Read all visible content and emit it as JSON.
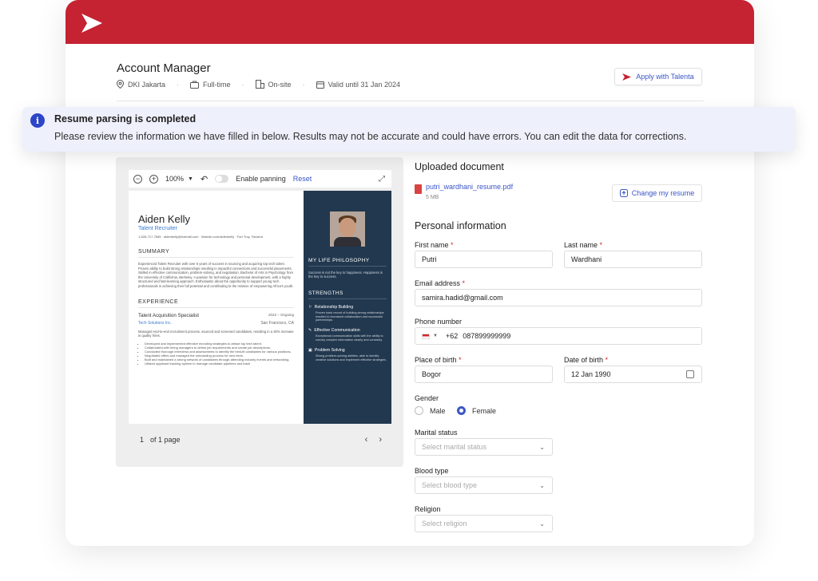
{
  "job": {
    "title": "Account Manager",
    "location": "DKI Jakarta",
    "type": "Full-time",
    "workplace": "On-site",
    "validity": "Valid until 31 Jan 2024",
    "apply_label": "Apply with Talenta"
  },
  "banner": {
    "title": "Resume parsing is completed",
    "message": "Please review the information we have filled in below. Results may not be accurate and could have errors. You can edit the data for corrections."
  },
  "viewer": {
    "zoom": "100%",
    "panning_label": "Enable panning",
    "reset_label": "Reset",
    "page_current": "1",
    "page_total": "of 1 page"
  },
  "resume": {
    "name": "Aiden Kelly",
    "role": "Talent Recruiter",
    "contact": "1-828-717-7665 · aidenkelly@hotmail.com · linkedin.com/aidenkelly · Fort Troy, Farwind",
    "summary_heading": "SUMMARY",
    "summary": "Experienced Talent Recruiter with over 5 years of success in sourcing and acquiring top tech talent. Proven ability to build strong relationships resulting in impactful connections and successful placements. Skilled in effective communication, problem-solving, and negotiation. Bachelor of Arts in Psychology from the University of California, Berkeley. A passion for technology and personal development, with a highly structured and fast-learning approach. Enthusiastic about the opportunity to support young tech professionals in achieving their full potential and contributing to the mission of empowering Africa's youth.",
    "experience_heading": "EXPERIENCE",
    "job_title": "Talent Acquisition Specialist",
    "job_dates": "2022 – Ongoing",
    "company": "Tech Solutions Inc.",
    "company_location": "San Francisco, CA",
    "job_intro": "Managed end-to-end recruitment process, sourced and screened candidates, resulting in a 30% increase in quality hires.",
    "bullets": [
      "Developed and implemented effective recruiting strategies to attract top tech talent.",
      "Collaborated with hiring managers to define job requirements and create job descriptions.",
      "Conducted thorough interviews and assessments to identify the best-fit candidates for various positions.",
      "Negotiated offers and managed the onboarding process for new hires.",
      "Built and maintained a strong network of candidates through attending industry events and networking.",
      "Utilized applicant tracking system to manage candidate pipelines and track"
    ],
    "philosophy_heading": "MY LIFE PHILOSOPHY",
    "philosophy": "Success is not the key to happiness. Happiness is the key to success.",
    "strengths_heading": "STRENGTHS",
    "strengths": [
      {
        "title": "Relationship Building",
        "text": "Proven track record of building strong relationships resulted in increased collaboration and successful partnerships."
      },
      {
        "title": "Effective Communication",
        "text": "Exceptional communication skills with the ability to convey complex information clearly and concisely."
      },
      {
        "title": "Problem Solving",
        "text": "Strong problem-solving abilities, able to identify creative solutions and implement effective strategies."
      }
    ]
  },
  "upload": {
    "heading": "Uploaded document",
    "file_name": "putri_wardhani_resume.pdf",
    "file_size": "5 MB",
    "change_label": "Change my resume"
  },
  "personal": {
    "heading": "Personal information",
    "first_name_label": "First name",
    "first_name": "Putri",
    "last_name_label": "Last name",
    "last_name": "Wardhani",
    "email_label": "Email address",
    "email": "samira.hadid@gmail.com",
    "phone_label": "Phone number",
    "phone_code": "+62",
    "phone": "087899999999",
    "pob_label": "Place of birth",
    "pob": "Bogor",
    "dob_label": "Date of birth",
    "dob": "12 Jan 1990",
    "gender_label": "Gender",
    "gender_male": "Male",
    "gender_female": "Female",
    "gender_selected": "Female",
    "marital_label": "Marital status",
    "marital_placeholder": "Select marital status",
    "blood_label": "Blood  type",
    "blood_placeholder": "Select blood type",
    "religion_label": "Religion",
    "religion_placeholder": "Select religion",
    "required_mark": "*"
  },
  "colors": {
    "brand_red": "#c52232",
    "accent_blue": "#3b56c7",
    "banner_bg": "#eef0fb",
    "resume_sidebar": "#22384f"
  },
  "icons": {
    "logo": "talenta-chevron-logo",
    "location": "pin-icon",
    "type": "briefcase-icon",
    "workplace": "building-icon",
    "validity": "calendar-icon",
    "info": "info-icon",
    "upload": "upload-icon",
    "pdf": "pdf-file-icon"
  }
}
